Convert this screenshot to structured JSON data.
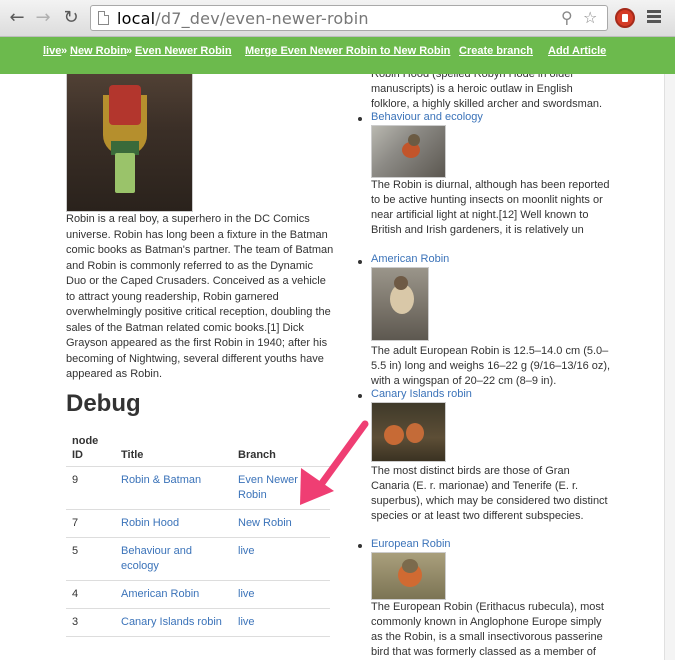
{
  "browser": {
    "url_host": "local",
    "url_path": "/d7_dev/even-newer-robin"
  },
  "toolbar": {
    "breadcrumb": [
      "live",
      "New Robin",
      "Even Newer Robin"
    ],
    "separator": "»",
    "actions": [
      "Merge Even Newer Robin to New Robin",
      "Create branch",
      "Add Article"
    ]
  },
  "main": {
    "body": "Robin is a real boy, a superhero in the DC Comics universe. Robin has long been a fixture in the Batman comic books as Batman's partner. The team of Batman and Robin is commonly referred to as the Dynamic Duo or the Caped Crusaders. Conceived as a vehicle to attract young readership, Robin garnered overwhelmingly positive critical reception, doubling the sales of the Batman related comic books.[1] Dick Grayson appeared as the first Robin in 1940; after his becoming of Nightwing, several different youths have appeared as Robin."
  },
  "debug": {
    "title": "Debug",
    "headers": [
      "node ID",
      "Title",
      "Branch"
    ],
    "rows": [
      {
        "nid": "9",
        "title": "Robin & Batman",
        "branch": "Even Newer Robin"
      },
      {
        "nid": "7",
        "title": "Robin Hood",
        "branch": "New Robin"
      },
      {
        "nid": "5",
        "title": "Behaviour and ecology",
        "branch": "live"
      },
      {
        "nid": "4",
        "title": "American Robin",
        "branch": "live"
      },
      {
        "nid": "3",
        "title": "Canary Islands robin",
        "branch": "live"
      }
    ]
  },
  "articles": {
    "robin_hood_text": "Robin Hood (spelled Robyn Hode in older manuscripts) is a heroic outlaw in English folklore, a highly skilled archer and swordsman.",
    "items": [
      {
        "title": "Behaviour and ecology",
        "text": "The Robin is diurnal, although has been reported to be active hunting insects on moonlit nights or near artificial light at night.[12] Well known to British and Irish gardeners, it is relatively un"
      },
      {
        "title": "American Robin",
        "text": "The adult European Robin is 12.5–14.0 cm (5.0–5.5 in) long and weighs 16–22 g (9/16–13/16 oz), with a wingspan of 20–22 cm (8–9 in)."
      },
      {
        "title": "Canary Islands robin",
        "text": "The most distinct birds are those of Gran Canaria (E. r. marionae) and Tenerife (E. r. superbus), which may be considered two distinct species or at least two different subspecies."
      },
      {
        "title": "European Robin",
        "text": "The European Robin (Erithacus rubecula), most commonly known in Anglophone Europe simply as the Robin, is a small insectivorous passerine bird that was formerly classed as a member of"
      }
    ]
  },
  "colors": {
    "toolbar_green": "#6cba4d",
    "link_blue": "#3b73b9",
    "arrow_pink": "#ef3e73"
  }
}
